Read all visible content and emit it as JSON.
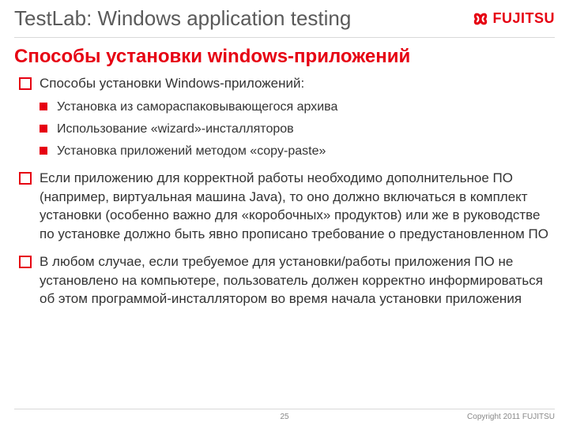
{
  "header": {
    "title": "TestLab: Windows application testing",
    "logo_text": "FUJITSU"
  },
  "title": "Способы установки windows-приложений",
  "bullets": [
    {
      "text": "Способы установки Windows-приложений:",
      "sub": [
        "Установка из самораспаковывающегося архива",
        "Использование «wizard»-инсталляторов",
        "Установка приложений методом «copy-paste»"
      ]
    },
    {
      "text": "Если приложению для корректной работы необходимо дополнительное ПО (например, виртуальная машина Java), то оно должно включаться в комплект установки (особенно важно для «коробочных» продуктов) или же в руководстве по установке должно быть явно прописано требование о предустановленном ПО"
    },
    {
      "text": "В любом случае, если требуемое для установки/работы приложения ПО не установлено на компьютере, пользователь должен корректно информироваться об этом программой-инсталлятором во время начала установки приложения"
    }
  ],
  "footer": {
    "page": "25",
    "copyright": "Copyright 2011 FUJITSU"
  }
}
